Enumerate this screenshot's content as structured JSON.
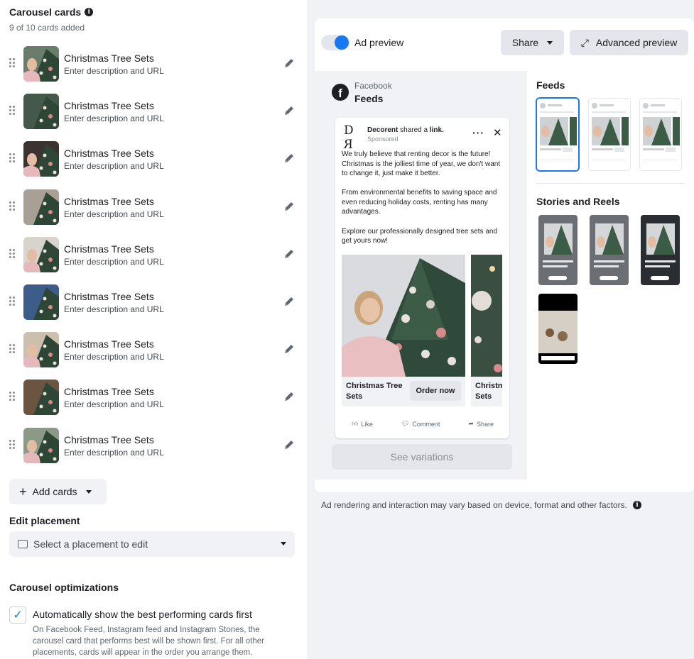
{
  "carousel": {
    "title": "Carousel cards",
    "count": "9 of 10 cards added",
    "cards": [
      {
        "title": "Christmas Tree Sets",
        "subtitle": "Enter description and URL"
      },
      {
        "title": "Christmas Tree Sets",
        "subtitle": "Enter description and URL"
      },
      {
        "title": "Christmas Tree Sets",
        "subtitle": "Enter description and URL"
      },
      {
        "title": "Christmas Tree Sets",
        "subtitle": "Enter description and URL"
      },
      {
        "title": "Christmas Tree Sets",
        "subtitle": "Enter description and URL"
      },
      {
        "title": "Christmas Tree Sets",
        "subtitle": "Enter description and URL"
      },
      {
        "title": "Christmas Tree Sets",
        "subtitle": "Enter description and URL"
      },
      {
        "title": "Christmas Tree Sets",
        "subtitle": "Enter description and URL"
      },
      {
        "title": "Christmas Tree Sets",
        "subtitle": "Enter description and URL"
      }
    ],
    "add_cards_label": "Add cards"
  },
  "placement": {
    "title": "Edit placement",
    "select_label": "Select a placement to edit"
  },
  "optimizations": {
    "title": "Carousel optimizations",
    "checkbox_label": "Automatically show the best performing cards first",
    "checkbox_checked": true,
    "description": "On Facebook Feed, Instagram feed and Instagram Stories, the carousel card that performs best will be shown first. For all other placements, cards will appear in the order you arrange them."
  },
  "preview": {
    "toggle_label": "Ad preview",
    "toggle_on": true,
    "share_label": "Share",
    "advanced_label": "Advanced preview",
    "platform": "Facebook",
    "placement": "Feeds",
    "post": {
      "brand": "Decorent",
      "shared_text": "shared a",
      "link_text": "link.",
      "sponsored": "Sponsored",
      "body": [
        "We truly believe that renting decor is the future! Christmas is the jolliest time of year, we don't want to change it, just make it better.",
        "From environmental benefits to saving space and even reducing holiday costs, renting has many advantages.",
        "Explore our professionally designed tree sets and get yours now!"
      ],
      "card_title": "Christmas Tree Sets",
      "card_button": "Order now",
      "card2_title": "Christm Sets",
      "actions": {
        "like": "Like",
        "comment": "Comment",
        "share": "Share"
      }
    },
    "see_variations": "See variations",
    "feeds_label": "Feeds",
    "stories_label": "Stories and Reels",
    "disclaimer": "Ad rendering and interaction may vary based on device, format and other factors."
  },
  "icons": {
    "info": "info-icon",
    "drag": "drag-handle-icon",
    "edit": "pencil-icon",
    "plus": "plus-icon",
    "caret": "caret-down-icon",
    "expand": "expand-icon",
    "facebook": "facebook-icon",
    "close": "close-icon",
    "more": "more-icon",
    "like": "like-icon",
    "comment": "comment-icon",
    "share": "share-icon",
    "check": "check-icon",
    "placement": "placement-icon"
  },
  "colors": {
    "accent": "#1877f2",
    "panel_bg": "#f0f2f5",
    "button_bg": "#e4e6eb",
    "text": "#1c1e21",
    "muted": "#606770"
  }
}
